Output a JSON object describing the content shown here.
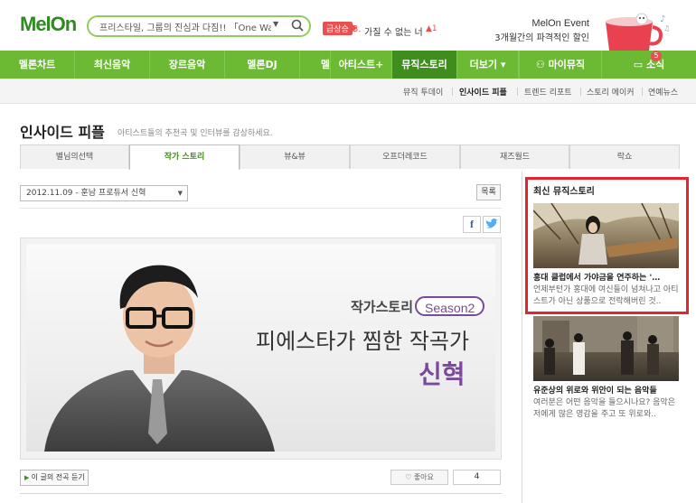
{
  "header": {
    "logo": "MelOn",
    "search_text": "프리스타일, 그룹의 진심과 다짐!! 「One Way」",
    "hot_badge": "급상승",
    "hot_rank": "3.",
    "hot_title": "가질 수 없는 너",
    "hot_change": "▲1",
    "event_title": "MelOn Event",
    "event_sub": "3개월간의 파격적인 할인"
  },
  "nav": {
    "items": [
      "멜론차트",
      "최신음악",
      "장르음악",
      "멜론DJ",
      "멜론TV",
      "아티스트+",
      "뮤직스토리",
      "더보기 ▾"
    ],
    "my_music": "마이뮤직",
    "news": "소식",
    "news_count": "5"
  },
  "subnav": {
    "items": [
      "뮤직 투데이",
      "인사이드 피플",
      "트렌드 리포트",
      "스토리 메이커",
      "연예뉴스"
    ]
  },
  "page": {
    "title": "인사이드 피플",
    "description": "아티스트들의 추천곡 및 인터뷰를 감상하세요."
  },
  "tabs": [
    "별님의선택",
    "작가 스토리",
    "뷰&뷰",
    "오프더레코드",
    "재즈월드",
    "락쇼"
  ],
  "toolbar": {
    "date_select": "2012.11.09 - 훈남 프로듀서 신혁",
    "list_label": "목록",
    "facebook": "f"
  },
  "banner": {
    "series": "작가스토리",
    "season": "Season2",
    "headline": "피에스타가 찜한 작곡가",
    "name": "신혁"
  },
  "bottom": {
    "listen_label": "이 글의 전곡 듣기",
    "like_label": "좋아요",
    "like_count": "4"
  },
  "sidebar": {
    "title": "최신 뮤직스토리",
    "stories": [
      {
        "headline": "홍대 클럽에서 가야금을 연주하는 '…",
        "desc": "언제부턴가 홍대에 여신들이 넘쳐나고 아티스트가 아닌 상품으로 전락해버린 것.."
      },
      {
        "headline": "유준상의 위로와 위안이 되는 음악들",
        "desc": "여러분은 어떤 음악을 들으시나요? 음악은 저에게 많은 영감을 주고 또 위로와.."
      }
    ]
  },
  "colors": {
    "nav_green": "#6cba34",
    "nav_active": "#3f8d1c",
    "highlight_red": "#e3262e",
    "banner_purple": "#7a4a9a"
  }
}
